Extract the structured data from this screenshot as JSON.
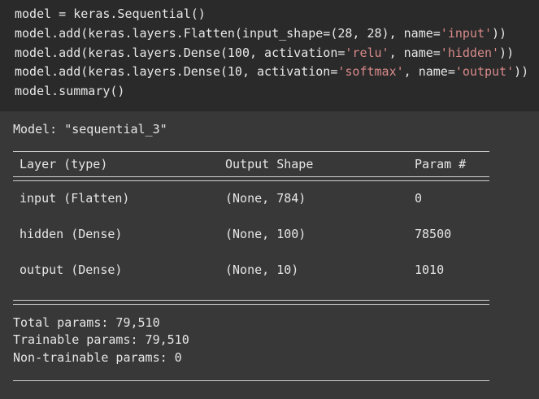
{
  "code": {
    "line1": "model = keras.Sequential()",
    "line2": {
      "pre": "model.add(keras.layers.Flatten(input_shape=(28, 28), name=",
      "str": "'input'",
      "post": "))"
    },
    "line3": {
      "pre": "model.add(keras.layers.Dense(100, activation=",
      "str1": "'relu'",
      "mid": ", name=",
      "str2": "'hidden'",
      "post": "))"
    },
    "line4": {
      "pre": "model.add(keras.layers.Dense(10, activation=",
      "str1": "'softmax'",
      "mid": ", name=",
      "str2": "'output'",
      "post": "))"
    },
    "line5": "model.summary()"
  },
  "summary": {
    "model_title": "Model: \"sequential_3\"",
    "headers": {
      "layer": "Layer (type)",
      "shape": "Output Shape",
      "params": "Param #"
    },
    "rows": [
      {
        "layer": "input (Flatten)",
        "shape": "(None, 784)",
        "params": "0"
      },
      {
        "layer": "hidden (Dense)",
        "shape": "(None, 100)",
        "params": "78500"
      },
      {
        "layer": "output (Dense)",
        "shape": "(None, 10)",
        "params": "1010"
      }
    ],
    "total": "Total params: 79,510",
    "trainable": "Trainable params: 79,510",
    "non_trainable": "Non-trainable params: 0"
  }
}
